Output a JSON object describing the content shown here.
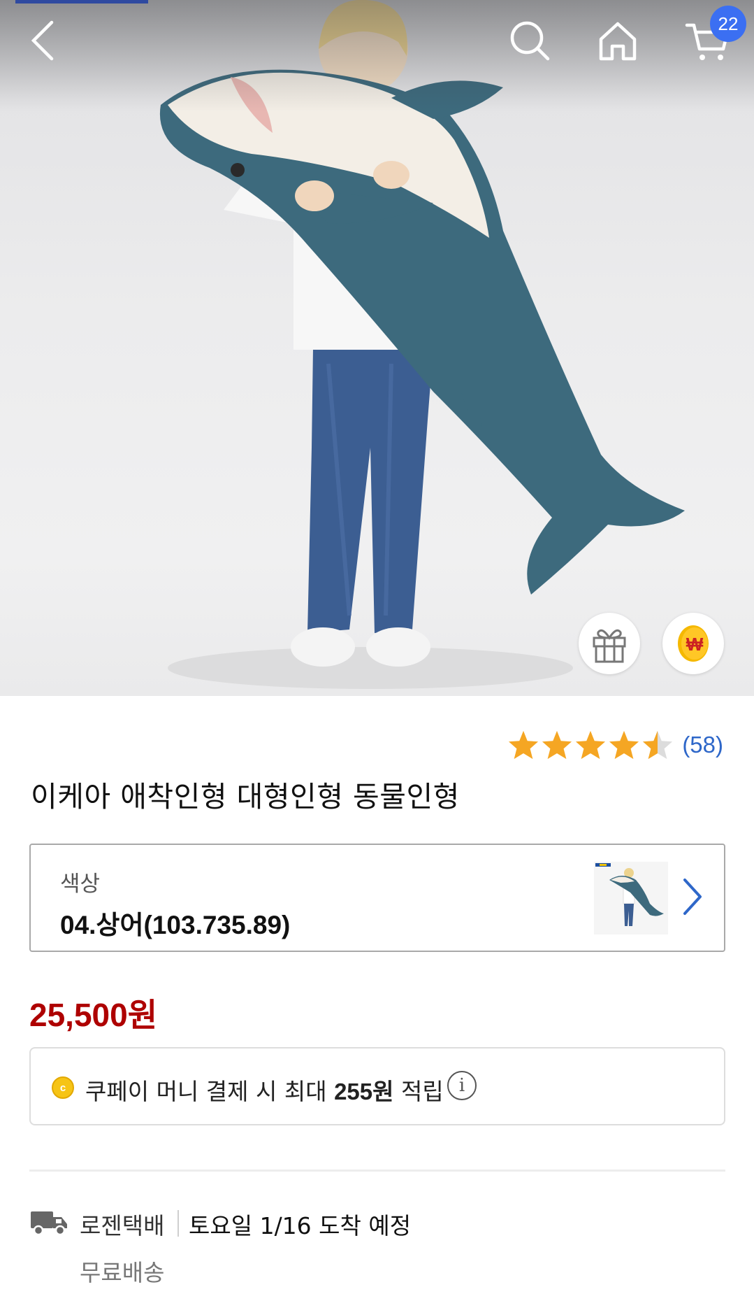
{
  "header": {
    "cart_count": "22",
    "icons": [
      "back-arrow-icon",
      "search-icon",
      "home-icon",
      "cart-icon"
    ]
  },
  "product": {
    "rating": 4.5,
    "review_count": "(58)",
    "title": "이케아 애착인형 대형인형 동물인형",
    "option": {
      "label": "색상",
      "value": "04.상어(103.735.89)"
    },
    "price": "25,500원",
    "reward": {
      "coin_letter": "c",
      "text_before": "쿠페이 머니 결제 시 최대",
      "amount": "255원",
      "text_after": "적립",
      "info_symbol": "i"
    },
    "delivery": {
      "courier": "로젠택배",
      "eta": "토요일 1/16 도착 예정",
      "fee": "무료배송"
    }
  },
  "colors": {
    "price": "#ae0000",
    "link": "#2e67c9",
    "badge": "#3b6ff2",
    "star": "#f5a623"
  }
}
